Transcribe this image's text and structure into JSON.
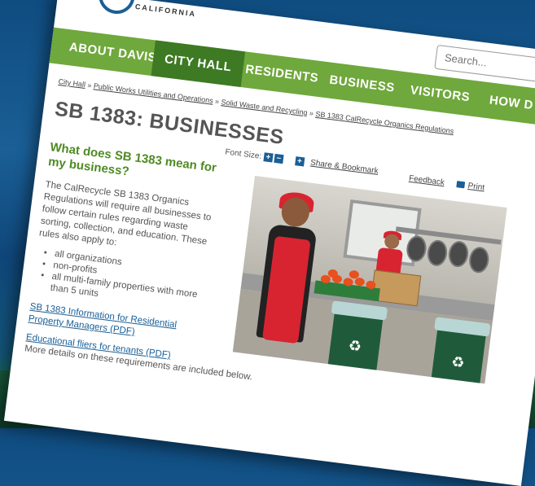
{
  "header": {
    "logo_text": "CALIFORNIA",
    "search_placeholder": "Search..."
  },
  "nav": {
    "items": [
      {
        "label": "ABOUT DAVIS"
      },
      {
        "label": "CITY HALL"
      },
      {
        "label": "RESIDENTS"
      },
      {
        "label": "BUSINESS"
      },
      {
        "label": "VISITORS"
      },
      {
        "label": "HOW D"
      }
    ]
  },
  "breadcrumb": {
    "items": [
      "City Hall",
      "Public Works Utilities and Operations",
      "Solid Waste and Recycling",
      "SB 1383 CalRecycle Organics Regulations"
    ],
    "separator": "»"
  },
  "page": {
    "title": "SB 1383: BUSINESSES"
  },
  "tools": {
    "font_size_label": "Font Size:",
    "plus": "+",
    "minus": "−",
    "share_label": "Share & Bookmark",
    "feedback_label": "Feedback",
    "print_label": "Print"
  },
  "content": {
    "heading": "What does SB 1383 mean for my business?",
    "intro": "The CalRecycle SB 1383 Organics Regulations will require all businesses to follow certain rules regarding waste sorting, collection, and education. These rules also apply to:",
    "bullets": [
      "all organizations",
      "non-profits",
      "all multi-family properties with more than 5 units"
    ],
    "links": [
      "SB 1383 Information for Residential Property Managers (PDF)",
      "Educational fliers for tenants (PDF)"
    ],
    "more": "More details on these requirements are included below."
  }
}
